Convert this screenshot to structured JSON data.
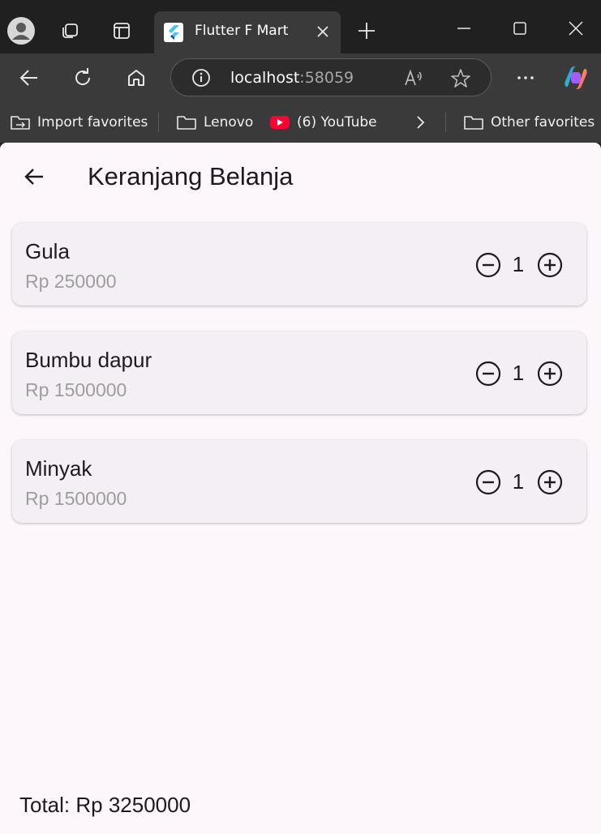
{
  "browser": {
    "tab_title": "Flutter F Mart",
    "url_host": "localhost",
    "url_port": ":58059",
    "favorites": [
      {
        "label": "Import favorites",
        "icon": "import-icon"
      },
      {
        "label": "Lenovo",
        "icon": "folder-icon"
      },
      {
        "label": "(6) YouTube",
        "icon": "youtube-icon"
      },
      {
        "label": "Other favorites",
        "icon": "folder-icon"
      }
    ]
  },
  "app": {
    "title": "Keranjang Belanja",
    "items": [
      {
        "name": "Gula",
        "price": "Rp 250000",
        "qty": "1"
      },
      {
        "name": "Bumbu dapur",
        "price": "Rp 1500000",
        "qty": "1"
      },
      {
        "name": "Minyak",
        "price": "Rp 1500000",
        "qty": "1"
      }
    ],
    "total": "Total: Rp 3250000"
  },
  "colors": {
    "app_background": "#fdf7fc",
    "card_background": "#f4eff4",
    "text_primary": "#1d1b20",
    "text_secondary": "#9e9e9e",
    "youtube_red": "#ff0033"
  }
}
